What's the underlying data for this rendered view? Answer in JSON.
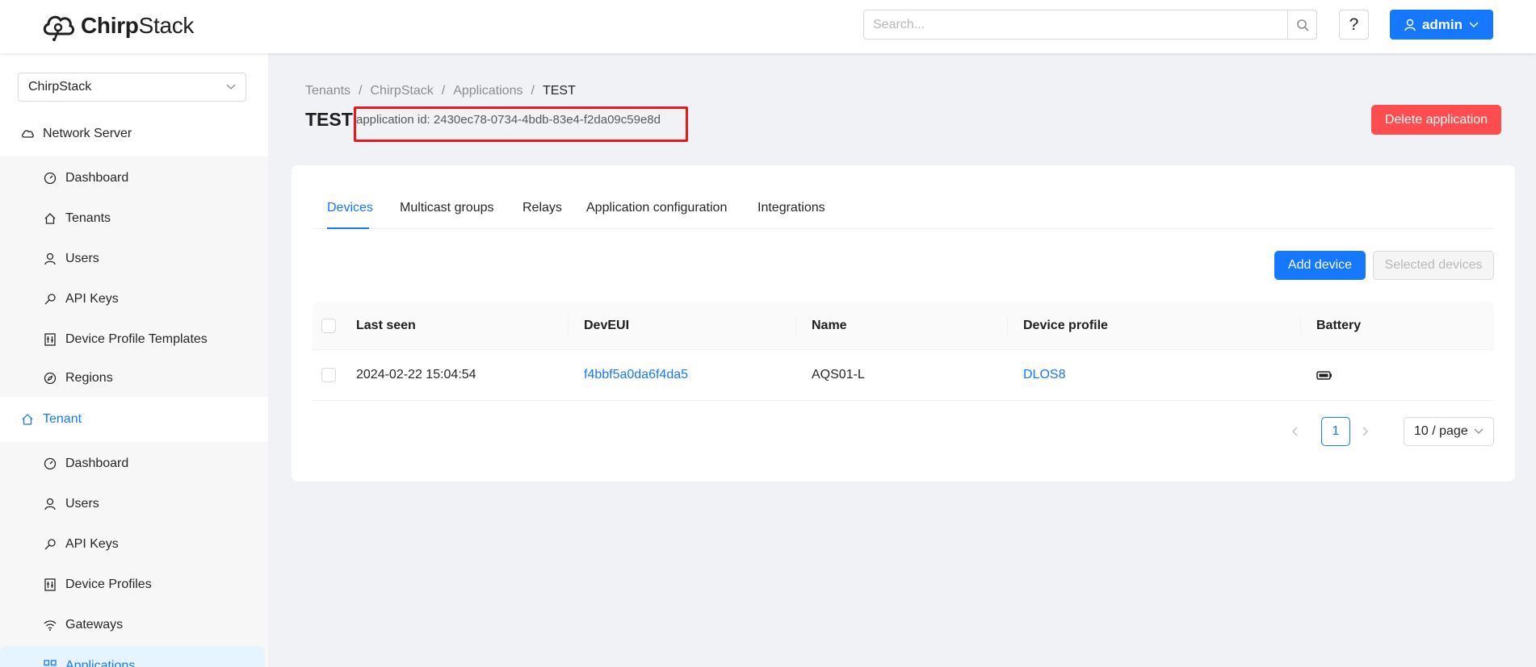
{
  "header": {
    "logo_text_bold": "Chirp",
    "logo_text_rest": "Stack",
    "search_placeholder": "Search...",
    "help_label": "?",
    "user_label": "admin"
  },
  "sidebar": {
    "tenant_select_value": "ChirpStack",
    "network_server_label": "Network Server",
    "network_server_items": [
      {
        "label": "Dashboard",
        "icon": "dashboard-icon"
      },
      {
        "label": "Tenants",
        "icon": "home-icon"
      },
      {
        "label": "Users",
        "icon": "user-icon"
      },
      {
        "label": "API Keys",
        "icon": "key-icon"
      },
      {
        "label": "Device Profile Templates",
        "icon": "profile-template-icon"
      },
      {
        "label": "Regions",
        "icon": "compass-icon"
      }
    ],
    "tenant_label": "Tenant",
    "tenant_items": [
      {
        "label": "Dashboard",
        "icon": "dashboard-icon"
      },
      {
        "label": "Users",
        "icon": "user-icon"
      },
      {
        "label": "API Keys",
        "icon": "key-icon"
      },
      {
        "label": "Device Profiles",
        "icon": "profile-icon"
      },
      {
        "label": "Gateways",
        "icon": "wifi-icon"
      },
      {
        "label": "Applications",
        "icon": "apps-icon"
      }
    ]
  },
  "breadcrumb": [
    "Tenants",
    "ChirpStack",
    "Applications",
    "TEST"
  ],
  "breadcrumb_separator": "/",
  "page": {
    "title": "TEST",
    "app_id_text": "application id: 2430ec78-0734-4bdb-83e4-f2da09c59e8d",
    "delete_label": "Delete application"
  },
  "tabs": [
    "Devices",
    "Multicast groups",
    "Relays",
    "Application configuration",
    "Integrations"
  ],
  "active_tab": "Devices",
  "actions": {
    "add_device": "Add device",
    "selected_devices": "Selected devices"
  },
  "table": {
    "headers": [
      "Last seen",
      "DevEUI",
      "Name",
      "Device profile",
      "Battery"
    ],
    "rows": [
      {
        "last_seen": "2024-02-22 15:04:54",
        "dev_eui": "f4bbf5a0da6f4da5",
        "name": "AQS01-L",
        "device_profile": "DLOS8",
        "battery_icon": "battery-icon"
      }
    ]
  },
  "pagination": {
    "current_page": "1",
    "page_size": "10 / page"
  },
  "colors": {
    "primary": "#1677ff",
    "danger": "#ff4d4f",
    "highlight": "#e81919"
  }
}
